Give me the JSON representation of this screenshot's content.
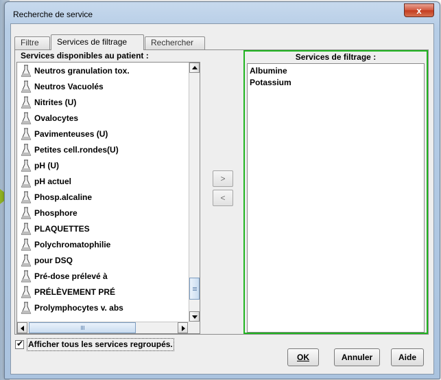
{
  "window": {
    "title": "Recherche de service",
    "close_label": "x"
  },
  "tabs": [
    {
      "label": "Filtre",
      "active": false
    },
    {
      "label": "Services de filtrage",
      "active": true
    },
    {
      "label": "Rechercher",
      "active": false
    }
  ],
  "available": {
    "header": "Services disponibles au patient :",
    "items": [
      "Neutros granulation tox.",
      "Neutros Vacuolés",
      "Nitrites (U)",
      "Ovalocytes",
      "Pavimenteuses (U)",
      "Petites cell.rondes(U)",
      "pH (U)",
      "pH actuel",
      "Phosp.alcaline",
      "Phosphore",
      "PLAQUETTES",
      "Polychromatophilie",
      "pour DSQ",
      "Pré-dose prélevé à",
      "PRÉLÈVEMENT PRÉ",
      "Prolymphocytes v. abs"
    ],
    "item_icon": "flask-icon"
  },
  "move": {
    "add_label": ">",
    "remove_label": "<"
  },
  "filter": {
    "header": "Services de filtrage :",
    "items": [
      "Albumine",
      "Potassium"
    ],
    "border_color": "#1fb51f"
  },
  "options": {
    "show_grouped_label": "Afficher tous les services regroupés.",
    "show_grouped_checked": true
  },
  "buttons": {
    "ok": "OK",
    "cancel": "Annuler",
    "help": "Aide"
  }
}
